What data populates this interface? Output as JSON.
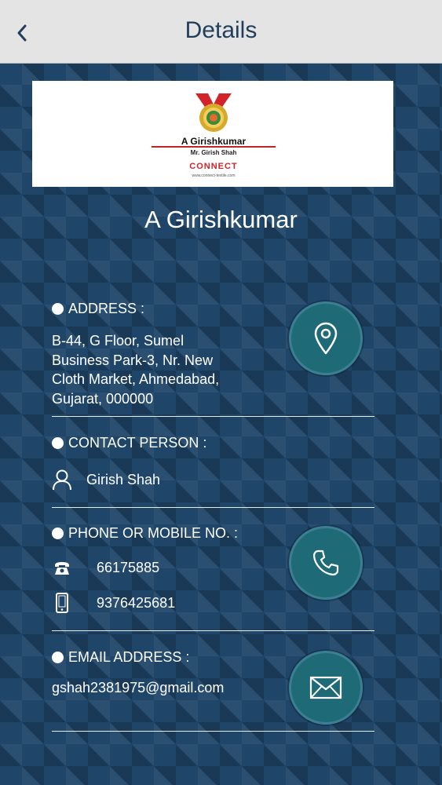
{
  "header": {
    "title": "Details",
    "back_icon": "chevron-left-icon"
  },
  "logo": {
    "brand_name": "A Girishkumar",
    "owner_line": "Mr. Girish Shah",
    "connect_text": "CONNECT",
    "website": "www.connect-textile.com"
  },
  "company_name": "A Girishkumar",
  "address": {
    "heading": "ADDRESS :",
    "lines": [
      "B-44, G Floor, Sumel",
      "Business Park-3, Nr. New",
      "Cloth Market, Ahmedabad,",
      "Gujarat, 000000"
    ],
    "button_icon": "location-pin-icon"
  },
  "contact": {
    "heading": "CONTACT PERSON :",
    "name": "Girish Shah",
    "icon": "person-icon"
  },
  "phone": {
    "heading": "PHONE OR MOBILE NO. :",
    "landline": "66175885",
    "mobile": "9376425681",
    "button_icon": "phone-icon"
  },
  "email": {
    "heading": "EMAIL ADDRESS :",
    "value": "gshah2381975@gmail.com",
    "button_icon": "envelope-icon"
  },
  "colors": {
    "navbar_bg": "#e3e4e3",
    "nav_title": "#203f5c",
    "page_bg": "#1f4669",
    "circle_button": "#1e6a77"
  }
}
